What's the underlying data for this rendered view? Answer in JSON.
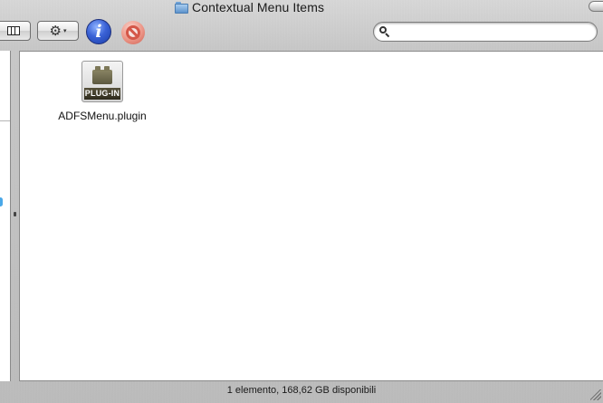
{
  "window": {
    "title": "Contextual Menu Items",
    "title_icon": "folder-icon"
  },
  "toolbar": {
    "view_button_icon": "columns-view-icon",
    "action_button_icon": "gear-icon",
    "action_caret": "▾",
    "info_glyph": "i",
    "info_button_icon": "info-icon",
    "delete_button_icon": "no-entry-icon",
    "search": {
      "value": "",
      "placeholder": ""
    }
  },
  "sidebar": {
    "visible_glyph": "i"
  },
  "content": {
    "items": [
      {
        "name": "ADFSMenu.plugin",
        "badge": "PLUG-IN",
        "icon": "plugin-icon"
      }
    ]
  },
  "status": {
    "text": "1 elemento, 168,62 GB disponibili"
  },
  "colors": {
    "info_blue": "#3a62d6",
    "no_entry_red": "#d64b3b",
    "search_bg": "#ffffff",
    "content_bg": "#ffffff"
  }
}
